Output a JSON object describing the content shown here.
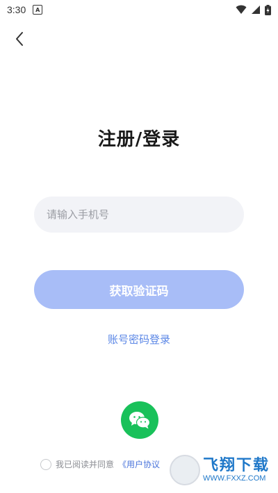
{
  "status_bar": {
    "time": "3:30",
    "notification_glyph": "A"
  },
  "title": "注册/登录",
  "phone_input": {
    "placeholder": "请输入手机号",
    "value": ""
  },
  "get_code_button": {
    "label": "获取验证码"
  },
  "password_login_link": {
    "label": "账号密码登录"
  },
  "agreement": {
    "prefix": "我已阅读并同意",
    "link": "《用户协议"
  },
  "watermark": {
    "title": "飞翔下载",
    "url": "WWW.FXXZ.COM"
  },
  "colors": {
    "primary_disabled": "#a8bdf7",
    "link": "#5a86e6",
    "wechat": "#19c15a"
  }
}
